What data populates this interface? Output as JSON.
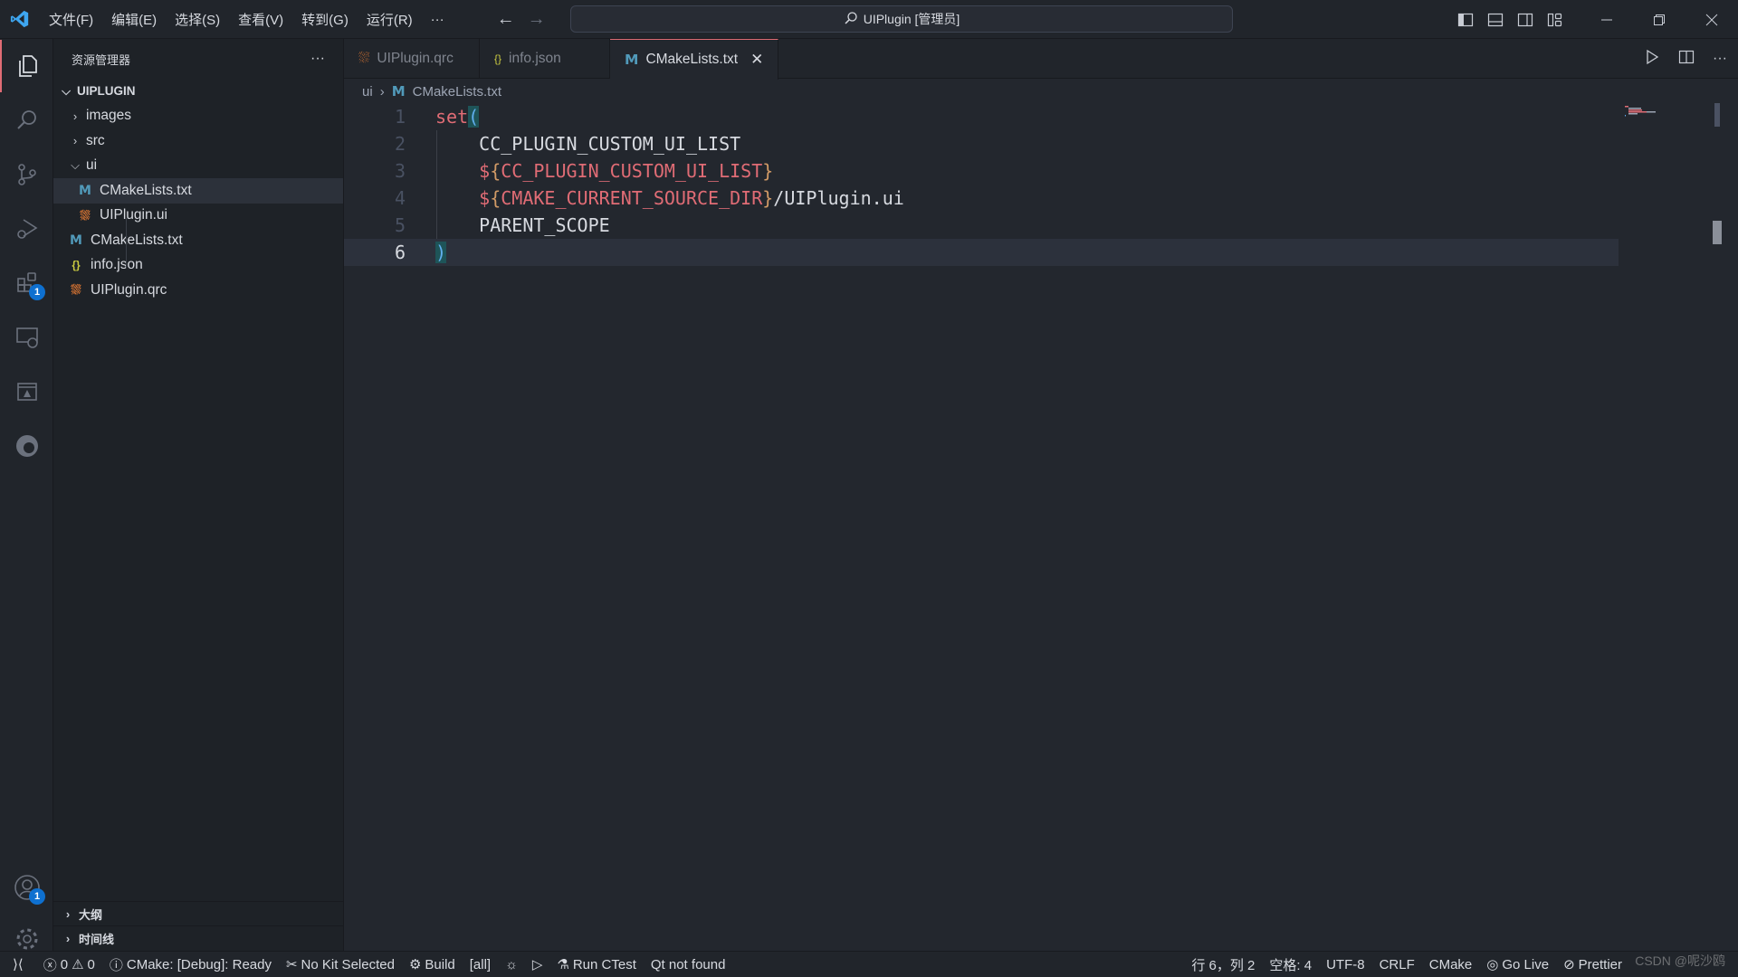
{
  "colors": {
    "accent": "#e06c75",
    "badge": "#0e70d0",
    "editor_bg": "#23272e"
  },
  "titlebar": {
    "menu": [
      "文件(F)",
      "编辑(E)",
      "选择(S)",
      "查看(V)",
      "转到(G)",
      "运行(R)",
      "···"
    ],
    "search": "UIPlugin [管理员]"
  },
  "activity": {
    "extensions_badge": "1",
    "accounts_badge": "1"
  },
  "sidebar": {
    "title": "资源管理器",
    "more": "···",
    "root": "UIPLUGIN",
    "items": [
      {
        "label": "images",
        "type": "folder"
      },
      {
        "label": "src",
        "type": "folder"
      },
      {
        "label": "ui",
        "type": "folder-open"
      },
      {
        "label": "CMakeLists.txt",
        "type": "cmake",
        "icon": "M"
      },
      {
        "label": "UIPlugin.ui",
        "type": "rss"
      },
      {
        "label": "CMakeLists.txt",
        "type": "cmake",
        "icon": "M"
      },
      {
        "label": "info.json",
        "type": "json",
        "icon": "{}"
      },
      {
        "label": "UIPlugin.qrc",
        "type": "rss"
      }
    ],
    "outline": "大纲",
    "timeline": "时间线"
  },
  "tabs": [
    {
      "label": "UIPlugin.qrc",
      "icon": "rss"
    },
    {
      "label": "info.json",
      "icon": "{}"
    },
    {
      "label": "CMakeLists.txt",
      "icon": "M",
      "active": true
    }
  ],
  "breadcrumb": {
    "folder": "ui",
    "icon": "M",
    "file": "CMakeLists.txt"
  },
  "editor": {
    "lines": [
      {
        "n": "1",
        "kw": "set",
        "par": "("
      },
      {
        "n": "2",
        "text": "    CC_PLUGIN_CUSTOM_UI_LIST"
      },
      {
        "n": "3",
        "indent": "    ",
        "d": "$",
        "ob": "{",
        "var": "CC_PLUGIN_CUSTOM_UI_LIST",
        "cb": "}",
        "rest": ""
      },
      {
        "n": "4",
        "indent": "    ",
        "d": "$",
        "ob": "{",
        "var": "CMAKE_CURRENT_SOURCE_DIR",
        "cb": "}",
        "rest": "/UIPlugin.ui"
      },
      {
        "n": "5",
        "text": "    PARENT_SCOPE"
      },
      {
        "n": "6",
        "par": ")"
      }
    ]
  },
  "statusbar": {
    "errors": "0",
    "warnings": "0",
    "cmake": "CMake: [Debug]: Ready",
    "kit": "No Kit Selected",
    "build": "Build",
    "target": "[all]",
    "ctest": "Run CTest",
    "qt": "Qt not found",
    "position": "行 6，列 2",
    "spaces": "空格: 4",
    "encoding": "UTF-8",
    "eol": "CRLF",
    "language": "CMake",
    "golive": "Go Live",
    "prettier": "Prettier"
  },
  "watermark": "CSDN @呢沙鸥"
}
